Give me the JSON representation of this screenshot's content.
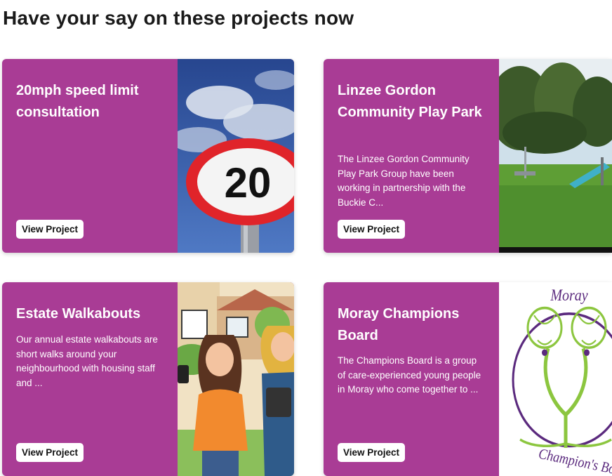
{
  "heading": "Have your say on these projects now",
  "projects": [
    {
      "title": "20mph speed limit consultation",
      "description": "",
      "button": "View Project",
      "image": "speed-limit-sign-20"
    },
    {
      "title": "Linzee Gordon Community Play Park",
      "description": "The Linzee Gordon Community Play Park Group have been working in partnership with the Buckie C...",
      "button": "View Project",
      "image": "play-park-photo"
    },
    {
      "title": "Estate Walkabouts",
      "description": "Our annual estate walkabouts are short walks around your neighbourhood with housing staff and ...",
      "button": "View Project",
      "image": "walkabout-illustration"
    },
    {
      "title": "Moray Champions Board",
      "description": "The Champions Board is a group of care-experienced young people in Moray who come together to ...",
      "button": "View Project",
      "image": "champions-board-logo",
      "logo_text_top": "Moray",
      "logo_text_bottom": "Champion's Bo"
    }
  ],
  "colors": {
    "card": "#a93c95",
    "logo_purple": "#5b2a7e",
    "logo_green": "#8cc63f"
  },
  "sign_number": "20"
}
